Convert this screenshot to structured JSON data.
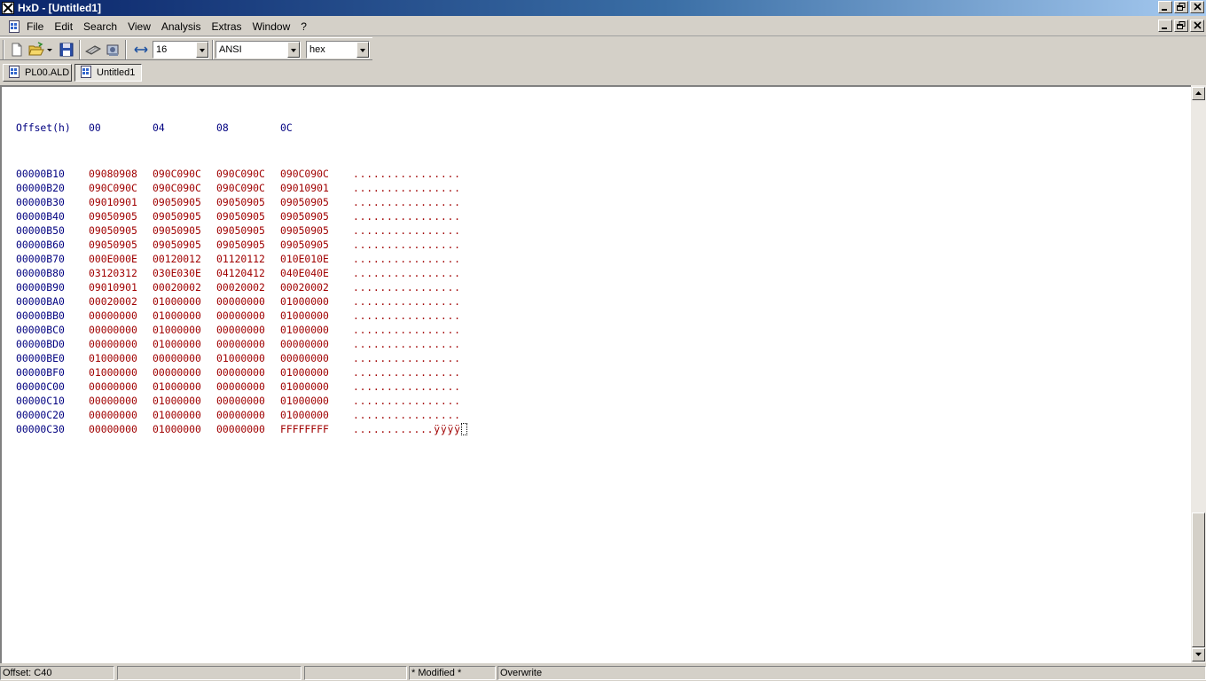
{
  "window": {
    "title": "HxD - [Untitled1]",
    "icon": "hxd-app-icon"
  },
  "menu": {
    "items": [
      "File",
      "Edit",
      "Search",
      "View",
      "Analysis",
      "Extras",
      "Window",
      "?"
    ]
  },
  "toolbar": {
    "bytes_per_row": "16",
    "charset": "ANSI",
    "offset_base": "hex",
    "icons": [
      "new-file-icon",
      "open-file-icon",
      "save-icon",
      "ram-icon",
      "disk-icon",
      "bytes-per-row-icon"
    ]
  },
  "tabs": [
    {
      "label": "PL00.ALD",
      "active": false
    },
    {
      "label": "Untitled1",
      "active": true
    }
  ],
  "hex_view": {
    "header": {
      "offset": "Offset(h)",
      "columns": [
        "00",
        "04",
        "08",
        "0C"
      ]
    },
    "rows": [
      {
        "offset": "00000B10",
        "hex": [
          "09080908",
          "090C090C",
          "090C090C",
          "090C090C"
        ],
        "ascii": "................"
      },
      {
        "offset": "00000B20",
        "hex": [
          "090C090C",
          "090C090C",
          "090C090C",
          "09010901"
        ],
        "ascii": "................"
      },
      {
        "offset": "00000B30",
        "hex": [
          "09010901",
          "09050905",
          "09050905",
          "09050905"
        ],
        "ascii": "................"
      },
      {
        "offset": "00000B40",
        "hex": [
          "09050905",
          "09050905",
          "09050905",
          "09050905"
        ],
        "ascii": "................"
      },
      {
        "offset": "00000B50",
        "hex": [
          "09050905",
          "09050905",
          "09050905",
          "09050905"
        ],
        "ascii": "................"
      },
      {
        "offset": "00000B60",
        "hex": [
          "09050905",
          "09050905",
          "09050905",
          "09050905"
        ],
        "ascii": "................"
      },
      {
        "offset": "00000B70",
        "hex": [
          "000E000E",
          "00120012",
          "01120112",
          "010E010E"
        ],
        "ascii": "................"
      },
      {
        "offset": "00000B80",
        "hex": [
          "03120312",
          "030E030E",
          "04120412",
          "040E040E"
        ],
        "ascii": "................"
      },
      {
        "offset": "00000B90",
        "hex": [
          "09010901",
          "00020002",
          "00020002",
          "00020002"
        ],
        "ascii": "................"
      },
      {
        "offset": "00000BA0",
        "hex": [
          "00020002",
          "01000000",
          "00000000",
          "01000000"
        ],
        "ascii": "................"
      },
      {
        "offset": "00000BB0",
        "hex": [
          "00000000",
          "01000000",
          "00000000",
          "01000000"
        ],
        "ascii": "................"
      },
      {
        "offset": "00000BC0",
        "hex": [
          "00000000",
          "01000000",
          "00000000",
          "01000000"
        ],
        "ascii": "................"
      },
      {
        "offset": "00000BD0",
        "hex": [
          "00000000",
          "01000000",
          "00000000",
          "00000000"
        ],
        "ascii": "................"
      },
      {
        "offset": "00000BE0",
        "hex": [
          "01000000",
          "00000000",
          "01000000",
          "00000000"
        ],
        "ascii": "................"
      },
      {
        "offset": "00000BF0",
        "hex": [
          "01000000",
          "00000000",
          "00000000",
          "01000000"
        ],
        "ascii": "................"
      },
      {
        "offset": "00000C00",
        "hex": [
          "00000000",
          "01000000",
          "00000000",
          "01000000"
        ],
        "ascii": "................"
      },
      {
        "offset": "00000C10",
        "hex": [
          "00000000",
          "01000000",
          "00000000",
          "01000000"
        ],
        "ascii": "................"
      },
      {
        "offset": "00000C20",
        "hex": [
          "00000000",
          "01000000",
          "00000000",
          "01000000"
        ],
        "ascii": "................"
      },
      {
        "offset": "00000C30",
        "hex": [
          "00000000",
          "01000000",
          "00000000",
          "FFFFFFFF"
        ],
        "ascii": "............ÿÿÿÿ"
      }
    ]
  },
  "statusbar": {
    "offset": "Offset: C40",
    "panel2": "",
    "panel3": "",
    "modified": "* Modified *",
    "mode": "Overwrite"
  },
  "colors": {
    "offset_text": "#000080",
    "hex_text": "#a00000",
    "titlebar_start": "#0a246a",
    "titlebar_end": "#a6caf0"
  }
}
